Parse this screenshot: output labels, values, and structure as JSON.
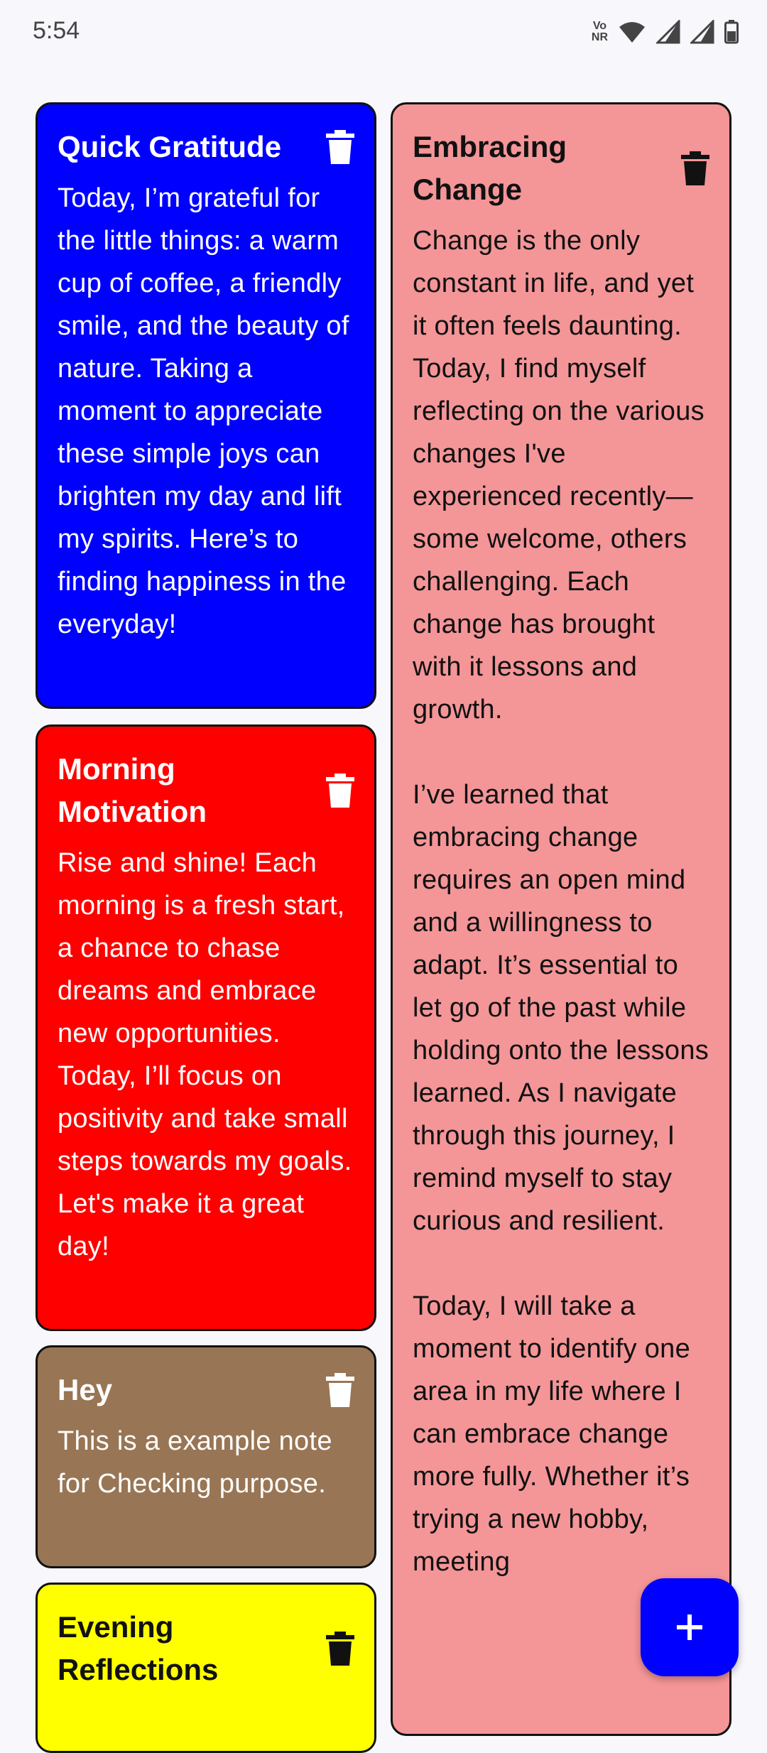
{
  "status_bar": {
    "time": "5:54",
    "volte_label": "Vo\nNR"
  },
  "notes": [
    {
      "title": "Quick Gratitude",
      "body": "Today, I’m grateful for the little things: a warm cup of coffee, a friendly smile, and the beauty of nature. Taking a moment to appreciate these simple joys can brighten my day and lift my spirits. Here’s to finding happiness in the everyday!",
      "bg_color": "#0000ff",
      "text_color": "#ffffff",
      "icon": "trash-icon"
    },
    {
      "title": "Embracing Change",
      "body": "Change is the only constant in life, and yet it often feels daunting. Today, I find myself reflecting on the various changes I've experienced recently—some welcome, others challenging. Each change has brought with it lessons and growth.\n\nI’ve learned that embracing change requires an open mind and a willingness to adapt. It’s essential to let go of the past while holding onto the lessons learned. As I navigate through this journey, I remind myself to stay curious and resilient.\n\nToday, I will take a moment to identify one area in my life where I can embrace change more fully. Whether it’s trying a new hobby, meeting",
      "bg_color": "#f49597",
      "text_color": "#111111",
      "icon": "trash-icon"
    },
    {
      "title": "Morning Motivation",
      "body": "Rise and shine! Each morning is a fresh start, a chance to chase dreams and embrace new opportunities. Today, I’ll focus on positivity and take small steps towards my goals. Let's make it a great day!",
      "bg_color": "#ff0000",
      "text_color": "#ffffff",
      "icon": "trash-icon"
    },
    {
      "title": "Hey",
      "body": "This is a example note for Checking purpose.",
      "bg_color": "#987554",
      "text_color": "#ffffff",
      "icon": "trash-icon"
    },
    {
      "title": "Evening Reflections",
      "body": "",
      "bg_color": "#ffff00",
      "text_color": "#111111",
      "icon": "trash-icon"
    }
  ],
  "fab": {
    "icon": "plus-icon",
    "color": "#0000ff"
  }
}
